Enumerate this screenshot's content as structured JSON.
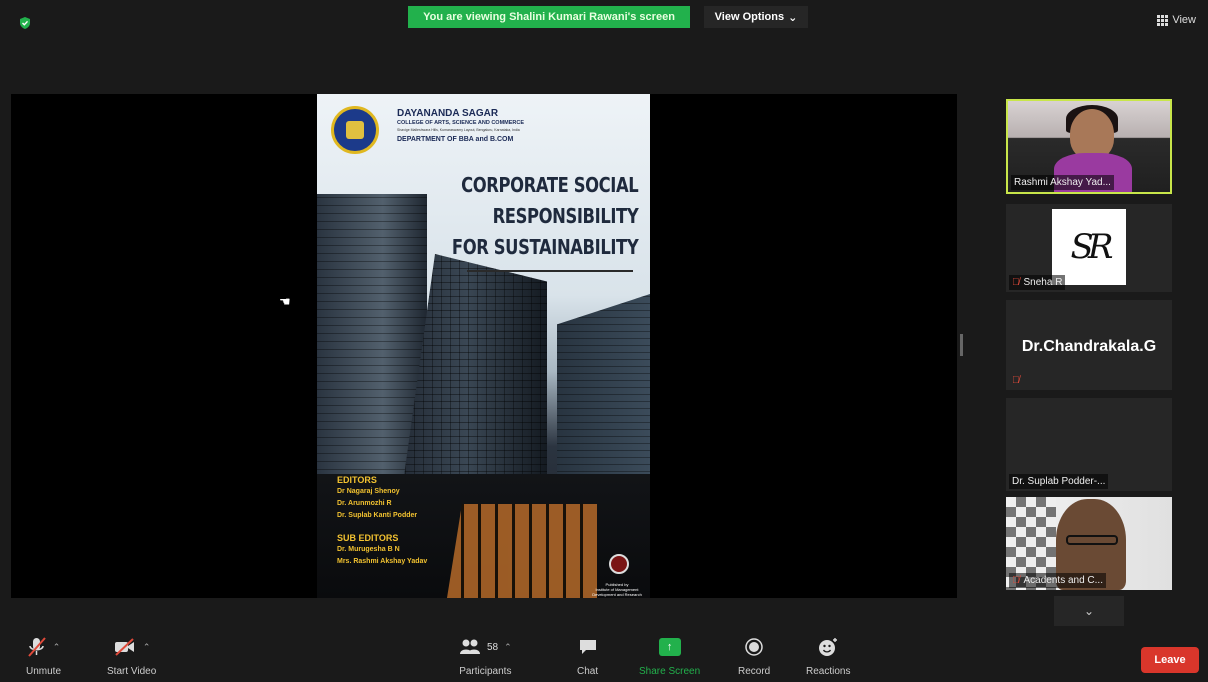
{
  "header": {
    "share_banner": "You are viewing Shalini Kumari Rawani's screen",
    "view_options": "View Options",
    "view": "View"
  },
  "shared_screen": {
    "college_name": "DAYANANDA SAGAR",
    "college_sub": "COLLEGE OF ARTS, SCIENCE AND COMMERCE",
    "college_addr": "Shavige Malleshwara Hills, Kumaraswamy Layout, Bengaluru, Karnataka, India",
    "department": "DEPARTMENT OF BBA and B.COM",
    "title_lines": [
      "CORPORATE SOCIAL",
      "RESPONSIBILITY",
      "FOR SUSTAINABILITY"
    ],
    "editors_heading": "EDITORS",
    "editors": [
      "Dr Nagaraj Shenoy",
      "Dr. Arunmozhi R",
      "Dr. Suplab Kanti Podder"
    ],
    "sub_editors_heading": "SUB EDITORS",
    "sub_editors": [
      "Dr. Murugesha B N",
      "Mrs. Rashmi Akshay Yadav"
    ],
    "publisher_label": "Published by",
    "publisher": "Institute of Management Development and Research"
  },
  "participants_panel": [
    {
      "name": "Rashmi Akshay Yad...",
      "muted": false
    },
    {
      "name": "Sneha R",
      "muted": true,
      "logo": "SR"
    },
    {
      "display": "Dr.Chandrakala.G",
      "muted": true
    },
    {
      "name": "Dr. Suplab Podder-...",
      "muted": false
    },
    {
      "name": "Acadents and C...",
      "muted": true
    }
  ],
  "toolbar": {
    "unmute": "Unmute",
    "start_video": "Start Video",
    "participants": "Participants",
    "participant_count": "58",
    "chat": "Chat",
    "share_screen": "Share Screen",
    "record": "Record",
    "reactions": "Reactions",
    "leave": "Leave"
  },
  "colors": {
    "share_green": "#22b14c",
    "active_speaker": "#c8e64a",
    "leave_red": "#d9362b"
  }
}
